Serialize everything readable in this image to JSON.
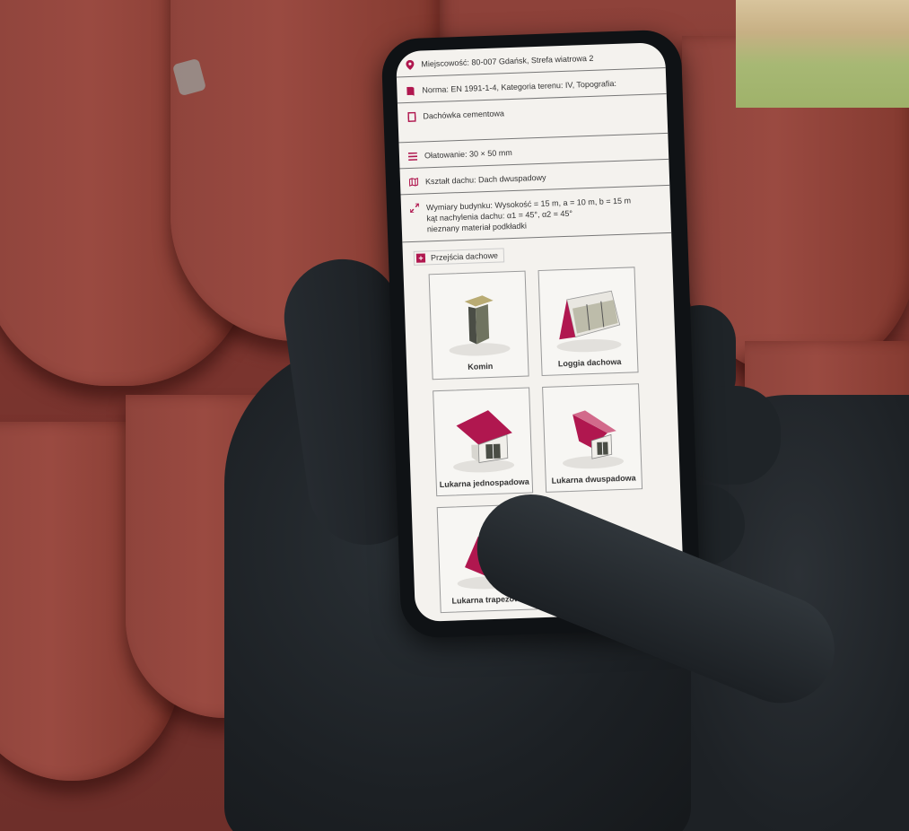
{
  "details": {
    "location": "Miejscowość: 80-007 Gdańsk, Strefa wiatrowa 2",
    "norm": "Norma: EN 1991-1-4, Kategoria terenu: IV, Topografia:",
    "tile": "Dachówka cementowa",
    "batten": "Ołatowanie: 30 × 50 mm",
    "roof_shape": "Kształt dachu: Dach dwuspadowy",
    "dimensions_line1": "Wymiary budynku: Wysokość = 15 m, a = 10 m, b = 15 m",
    "dimensions_line2": "kąt nachylenia dachu: α1 = 45°, α2 = 45°",
    "dimensions_line3": "nieznany materiał podkładki"
  },
  "section": {
    "title": "Przejścia dachowe"
  },
  "options": [
    {
      "label": "Komin"
    },
    {
      "label": "Loggia dachowa"
    },
    {
      "label": "Lukarna jednospadowa"
    },
    {
      "label": "Lukarna dwuspadowa"
    },
    {
      "label": "Lukarna trapezowa"
    }
  ],
  "colors": {
    "accent": "#b0174f",
    "tile": "#8f443c",
    "glove": "#1f2428"
  },
  "icons": {
    "location": "map-pin-icon",
    "norm": "book-icon",
    "tile": "square-icon",
    "batten": "lines-icon",
    "roof_shape": "map-icon",
    "dimensions": "resize-icon",
    "section": "plus-icon"
  }
}
